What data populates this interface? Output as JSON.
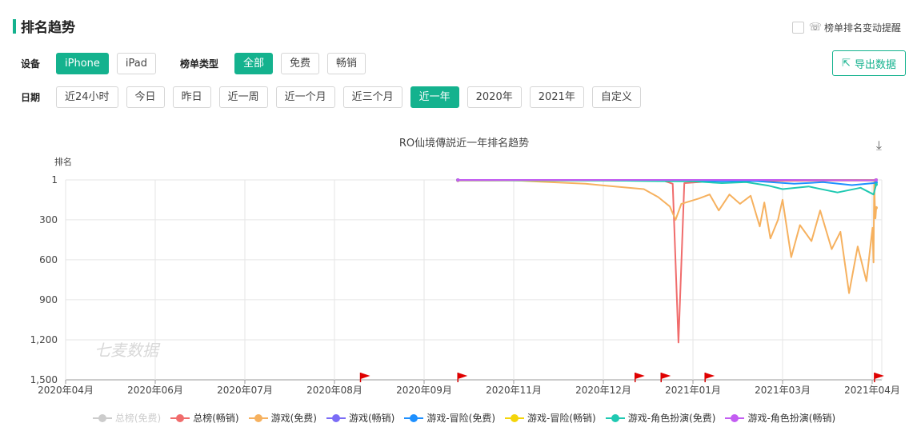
{
  "page": {
    "title": "排名趋势",
    "remind_label": "榜单排名变动提醒",
    "export_label": "导出数据"
  },
  "filters": {
    "device_label": "设备",
    "devices": [
      "iPhone",
      "iPad"
    ],
    "device_active": 0,
    "list_type_label": "榜单类型",
    "list_types": [
      "全部",
      "免费",
      "畅销"
    ],
    "list_type_active": 0,
    "date_label": "日期",
    "dates": [
      "近24小时",
      "今日",
      "昨日",
      "近一周",
      "近一个月",
      "近三个月",
      "近一年",
      "2020年",
      "2021年",
      "自定义"
    ],
    "date_active": 6
  },
  "colors": {
    "accent": "#14b28e"
  },
  "chart_data": {
    "type": "line",
    "title": "RO仙境傳説近一年排名趋势",
    "ylabel": "排名",
    "y_inverted": true,
    "ylim": [
      1,
      1500
    ],
    "yticks": [
      "1",
      "300",
      "600",
      "900",
      "1,200",
      "1,500"
    ],
    "ytick_values": [
      1,
      300,
      600,
      900,
      1200,
      1500
    ],
    "x_dates": [
      "2020-04",
      "2020-06",
      "2020-07",
      "2020-08",
      "2020-09",
      "2020-11",
      "2020-12",
      "2021-01",
      "2021-03",
      "2021-04"
    ],
    "xticks": [
      "2020年04月",
      "2020年06月",
      "2020年07月",
      "2020年08月",
      "2020年09月",
      "2020年11月",
      "2020年12月",
      "2021年01月",
      "2021年03月",
      "2021年04月"
    ],
    "watermark": "七麦数据",
    "flags_at": [
      "2020-08-10",
      "2020-09-24",
      "2020-12-12",
      "2020-12-21",
      "2021-01-09",
      "2021-04-08"
    ],
    "series": [
      {
        "name": "总榜(免费)",
        "color": "#cccccc",
        "visible": false,
        "points": []
      },
      {
        "name": "总榜(畅销)",
        "color": "#f06c6c",
        "visible": true,
        "points": [
          [
            "2020-09-24",
            5
          ],
          [
            "2020-11-01",
            5
          ],
          [
            "2020-12-01",
            6
          ],
          [
            "2020-12-22",
            8
          ],
          [
            "2020-12-25",
            30
          ],
          [
            "2020-12-27",
            1220
          ],
          [
            "2020-12-29",
            25
          ],
          [
            "2021-01-15",
            10
          ],
          [
            "2021-02-15",
            8
          ],
          [
            "2021-03-20",
            6
          ],
          [
            "2021-04-10",
            5
          ]
        ]
      },
      {
        "name": "游戏(免费)",
        "color": "#f6b15f",
        "visible": true,
        "points": [
          [
            "2020-09-24",
            2
          ],
          [
            "2020-10-15",
            3
          ],
          [
            "2020-11-01",
            4
          ],
          [
            "2020-11-10",
            15
          ],
          [
            "2020-11-25",
            30
          ],
          [
            "2020-12-05",
            50
          ],
          [
            "2020-12-15",
            70
          ],
          [
            "2020-12-20",
            130
          ],
          [
            "2020-12-24",
            200
          ],
          [
            "2020-12-26",
            300
          ],
          [
            "2020-12-28",
            180
          ],
          [
            "2021-01-05",
            140
          ],
          [
            "2021-01-12",
            110
          ],
          [
            "2021-01-18",
            230
          ],
          [
            "2021-01-25",
            110
          ],
          [
            "2021-02-01",
            180
          ],
          [
            "2021-02-08",
            120
          ],
          [
            "2021-02-14",
            350
          ],
          [
            "2021-02-17",
            170
          ],
          [
            "2021-02-21",
            440
          ],
          [
            "2021-02-26",
            300
          ],
          [
            "2021-03-01",
            150
          ],
          [
            "2021-03-04",
            580
          ],
          [
            "2021-03-07",
            340
          ],
          [
            "2021-03-11",
            460
          ],
          [
            "2021-03-14",
            230
          ],
          [
            "2021-03-18",
            520
          ],
          [
            "2021-03-21",
            390
          ],
          [
            "2021-03-24",
            850
          ],
          [
            "2021-03-27",
            500
          ],
          [
            "2021-03-30",
            760
          ],
          [
            "2021-04-02",
            360
          ],
          [
            "2021-04-05",
            620
          ],
          [
            "2021-04-07",
            2
          ],
          [
            "2021-04-09",
            180
          ],
          [
            "2021-04-11",
            290
          ],
          [
            "2021-04-13",
            210
          ]
        ]
      },
      {
        "name": "游戏(畅销)",
        "color": "#7b6cf6",
        "visible": true,
        "points": [
          [
            "2020-09-24",
            1
          ],
          [
            "2020-12-01",
            1
          ],
          [
            "2021-02-01",
            1
          ],
          [
            "2021-03-25",
            2
          ],
          [
            "2021-04-05",
            3
          ],
          [
            "2021-04-09",
            1
          ],
          [
            "2021-04-13",
            1
          ]
        ]
      },
      {
        "name": "游戏-冒险(免费)",
        "color": "#1e90ff",
        "visible": true,
        "points": [
          [
            "2020-09-24",
            1
          ],
          [
            "2020-11-01",
            2
          ],
          [
            "2020-12-01",
            4
          ],
          [
            "2021-01-01",
            6
          ],
          [
            "2021-01-20",
            12
          ],
          [
            "2021-02-10",
            8
          ],
          [
            "2021-02-25",
            20
          ],
          [
            "2021-03-05",
            30
          ],
          [
            "2021-03-15",
            18
          ],
          [
            "2021-03-25",
            40
          ],
          [
            "2021-04-05",
            25
          ],
          [
            "2021-04-13",
            20
          ]
        ]
      },
      {
        "name": "游戏-冒险(畅销)",
        "color": "#f4d50b",
        "visible": true,
        "points": [
          [
            "2020-09-24",
            1
          ],
          [
            "2021-04-13",
            1
          ]
        ]
      },
      {
        "name": "游戏-角色扮演(免费)",
        "color": "#1fc9b2",
        "visible": true,
        "points": [
          [
            "2020-09-24",
            2
          ],
          [
            "2020-11-01",
            3
          ],
          [
            "2020-12-01",
            5
          ],
          [
            "2020-12-20",
            10
          ],
          [
            "2021-01-01",
            12
          ],
          [
            "2021-01-20",
            25
          ],
          [
            "2021-02-05",
            18
          ],
          [
            "2021-02-20",
            45
          ],
          [
            "2021-03-01",
            70
          ],
          [
            "2021-03-10",
            50
          ],
          [
            "2021-03-20",
            95
          ],
          [
            "2021-03-28",
            60
          ],
          [
            "2021-04-05",
            110
          ],
          [
            "2021-04-13",
            35
          ]
        ]
      },
      {
        "name": "游戏-角色扮演(畅销)",
        "color": "#c35df2",
        "visible": true,
        "points": [
          [
            "2020-09-24",
            1
          ],
          [
            "2021-03-01",
            1
          ],
          [
            "2021-04-05",
            2
          ],
          [
            "2021-04-13",
            1
          ]
        ]
      }
    ]
  }
}
